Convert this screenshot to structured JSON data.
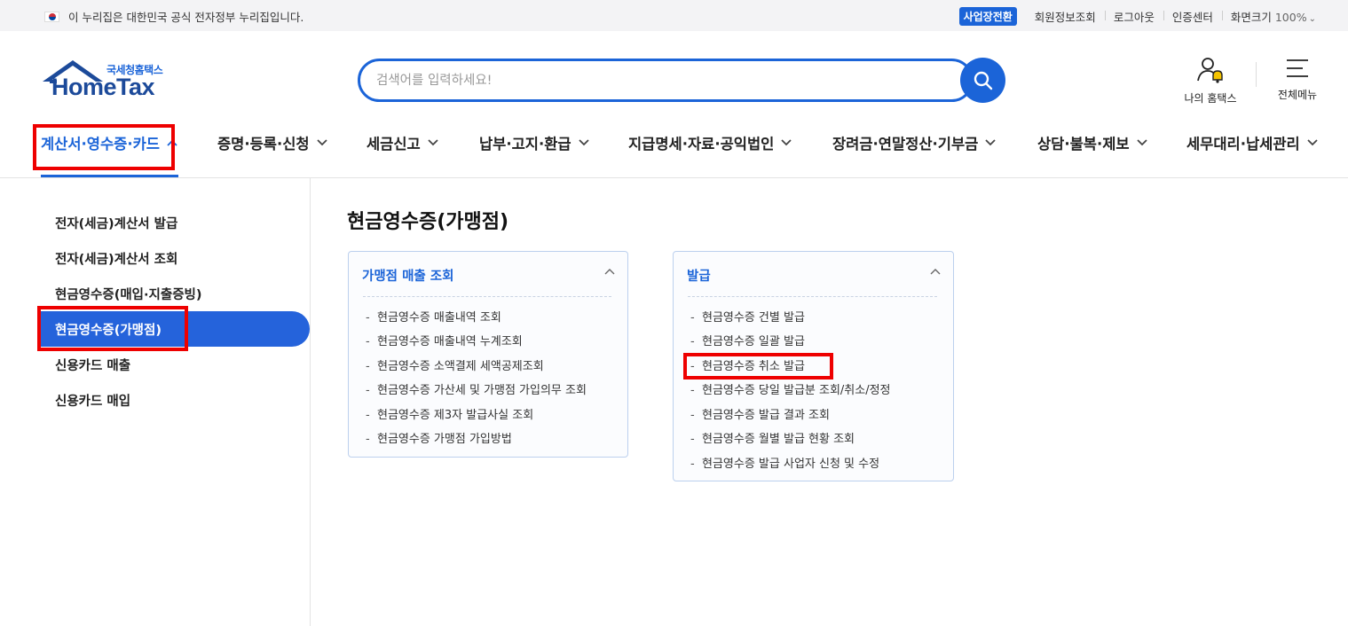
{
  "gov_bar": {
    "notice": "이 누리집은 대한민국 공식 전자정부 누리집입니다.",
    "biz_switch": "사업장전환",
    "links": [
      "회원정보조회",
      "로그아웃",
      "인증센터"
    ],
    "zoom_label": "화면크기",
    "zoom_value": "100%"
  },
  "logo": {
    "sub": "국세청홈택스",
    "main": "HomeTax"
  },
  "search": {
    "placeholder": "검색어를 입력하세요!"
  },
  "header": {
    "my_hometax": "나의 홈택스",
    "all_menu": "전체메뉴"
  },
  "gnb": [
    {
      "label": "계산서·영수증·카드",
      "active": true
    },
    {
      "label": "증명·등록·신청"
    },
    {
      "label": "세금신고"
    },
    {
      "label": "납부·고지·환급"
    },
    {
      "label": "지급명세·자료·공익법인"
    },
    {
      "label": "장려금·연말정산·기부금"
    },
    {
      "label": "상담·불복·제보"
    },
    {
      "label": "세무대리·납세관리"
    }
  ],
  "sidebar": [
    {
      "label": "전자(세금)계산서 발급"
    },
    {
      "label": "전자(세금)계산서 조회"
    },
    {
      "label": "현금영수증(매입·지출증빙)"
    },
    {
      "label": "현금영수증(가맹점)",
      "active": true
    },
    {
      "label": "신용카드 매출"
    },
    {
      "label": "신용카드 매입"
    }
  ],
  "main": {
    "title": "현금영수증(가맹점)",
    "cards": [
      {
        "title": "가맹점 매출 조회",
        "links": [
          "현금영수증 매출내역 조회",
          "현금영수증 매출내역 누계조회",
          "현금영수증 소액결제 세액공제조회",
          "현금영수증 가산세 및 가맹점 가입의무 조회",
          "현금영수증 제3자 발급사실 조회",
          "현금영수증 가맹점 가입방법"
        ]
      },
      {
        "title": "발급",
        "links": [
          "현금영수증 건별 발급",
          "현금영수증 일괄 발급",
          "현금영수증 취소 발급",
          "현금영수증 당일 발급분 조회/취소/정정",
          "현금영수증 발급 결과 조회",
          "현금영수증 월별 발급 현황 조회",
          "현금영수증 발급 사업자 신청 및 수정"
        ]
      }
    ]
  },
  "colors": {
    "accent": "#1b64d8",
    "highlight": "#ee0000",
    "logo": "#1c4a9a"
  }
}
